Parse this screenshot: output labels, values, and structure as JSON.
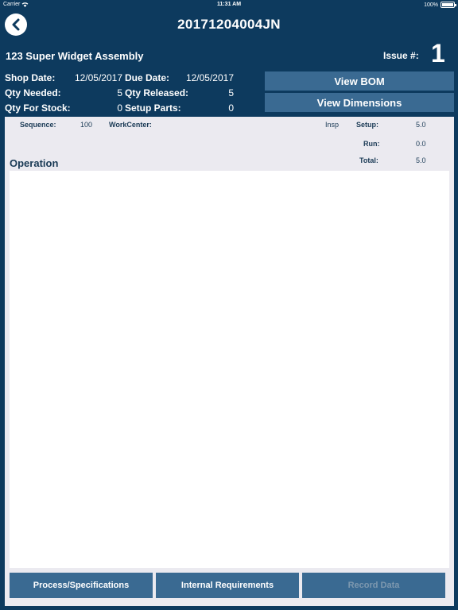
{
  "status_bar": {
    "carrier": "Carrier",
    "time": "11:31 AM",
    "battery": "100%"
  },
  "nav": {
    "title": "20171204004JN",
    "back_icon": "chevron-left-icon"
  },
  "job": {
    "part_name": "123 Super Widget Assembly",
    "issue_label": "Issue #:",
    "issue_value": "1"
  },
  "info": {
    "shop_date_label": "Shop Date:",
    "shop_date_value": "12/05/2017",
    "due_date_label": "Due Date:",
    "due_date_value": "12/05/2017",
    "qty_needed_label": "Qty Needed:",
    "qty_needed_value": "5",
    "qty_released_label": "Qty Released:",
    "qty_released_value": "5",
    "qty_for_stock_label": "Qty For Stock:",
    "qty_for_stock_value": "0",
    "setup_parts_label": "Setup Parts:",
    "setup_parts_value": "0"
  },
  "actions": {
    "view_bom": "View BOM",
    "view_dimensions": "View Dimensions"
  },
  "operation": {
    "sequence_label": "Sequence:",
    "sequence_value": "100",
    "workcenter_label": "WorkCenter:",
    "workcenter_value": "Insp",
    "setup_label": "Setup:",
    "setup_value": "5.0",
    "run_label": "Run:",
    "run_value": "0.0",
    "total_label": "Total:",
    "total_value": "5.0",
    "title": "Operation",
    "body": ""
  },
  "bottom_buttons": {
    "process_specs": "Process/Specifications",
    "internal_requirements": "Internal Requirements",
    "record_data": "Record Data"
  },
  "colors": {
    "background": "#0d3a5e",
    "button": "#3a6a92",
    "panel": "#ebeaf0",
    "disabled_text": "#7d98af"
  }
}
